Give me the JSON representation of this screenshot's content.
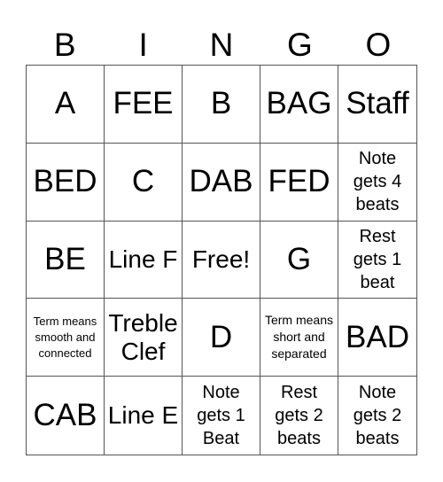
{
  "header": [
    "B",
    "I",
    "N",
    "G",
    "O"
  ],
  "cells": [
    {
      "text": "A",
      "size": "xl"
    },
    {
      "text": "FEE",
      "size": "xl"
    },
    {
      "text": "B",
      "size": "xl"
    },
    {
      "text": "BAG",
      "size": "xl"
    },
    {
      "text": "Staff",
      "size": "xl"
    },
    {
      "text": "BED",
      "size": "xl"
    },
    {
      "text": "C",
      "size": "xl"
    },
    {
      "text": "DAB",
      "size": "xl"
    },
    {
      "text": "FED",
      "size": "xl"
    },
    {
      "text": "Note gets 4 beats",
      "size": "md"
    },
    {
      "text": "BE",
      "size": "xl"
    },
    {
      "text": "Line F",
      "size": "lg"
    },
    {
      "text": "Free!",
      "size": "lg"
    },
    {
      "text": "G",
      "size": "xl"
    },
    {
      "text": "Rest gets 1 beat",
      "size": "md"
    },
    {
      "text": "Term means smooth and connected",
      "size": "xs"
    },
    {
      "text": "Treble Clef",
      "size": "lg"
    },
    {
      "text": "D",
      "size": "xl"
    },
    {
      "text": "Term means short and separated",
      "size": "sm"
    },
    {
      "text": "BAD",
      "size": "xl"
    },
    {
      "text": "CAB",
      "size": "xl"
    },
    {
      "text": "Line E",
      "size": "lg"
    },
    {
      "text": "Note gets 1 Beat",
      "size": "md"
    },
    {
      "text": "Rest gets 2 beats",
      "size": "md"
    },
    {
      "text": "Note gets 2 beats",
      "size": "md"
    }
  ]
}
